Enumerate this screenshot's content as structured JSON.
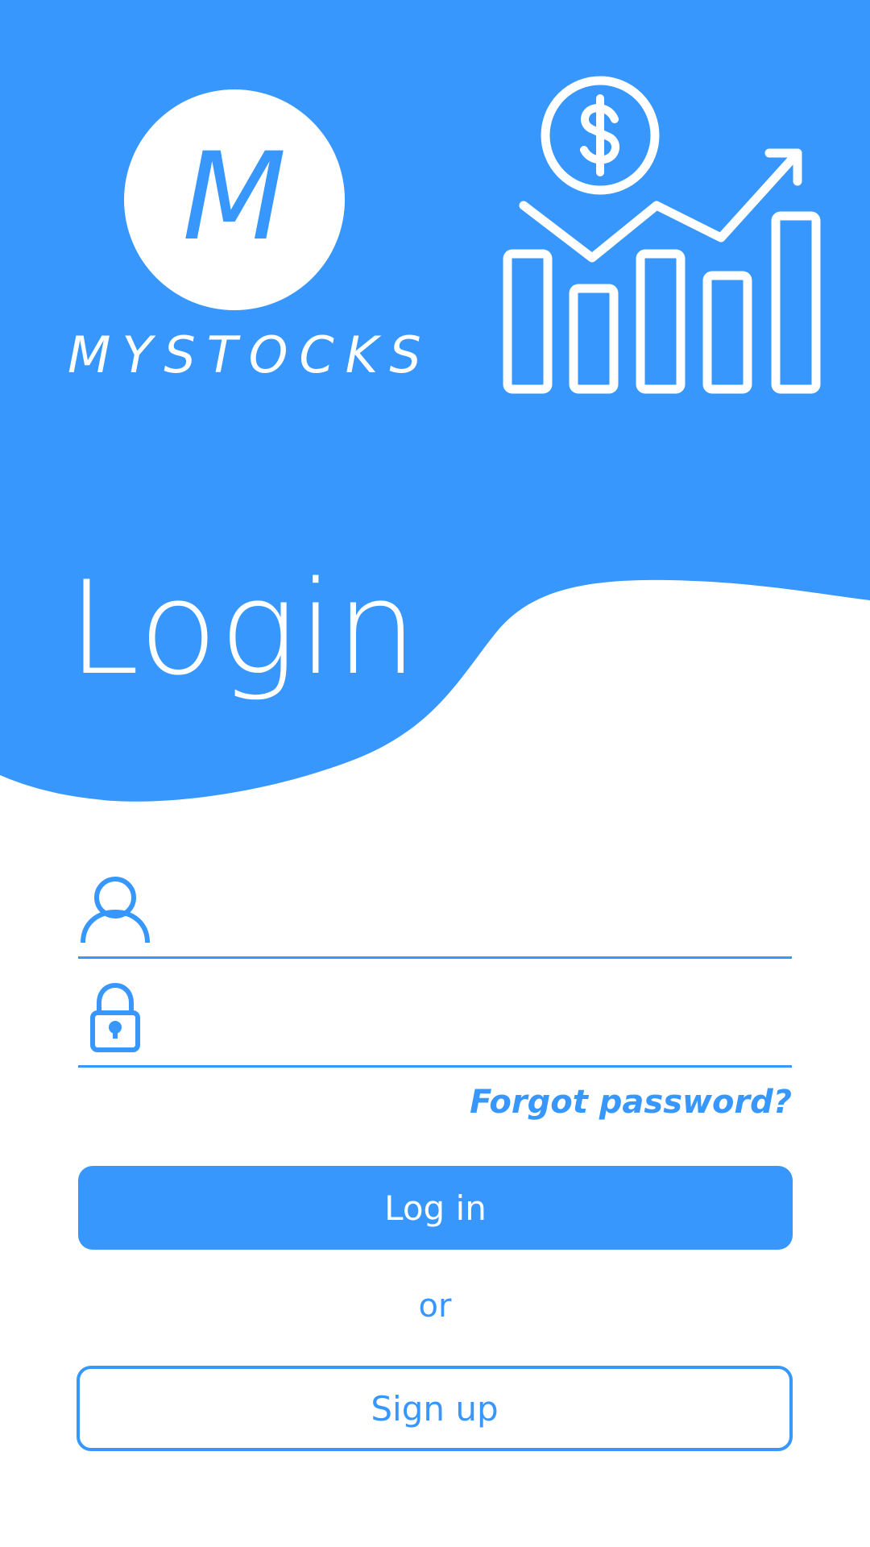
{
  "brand": {
    "logo_letter": "M",
    "name": "MYSTOCKS"
  },
  "page": {
    "title": "Login"
  },
  "form": {
    "username": {
      "value": "",
      "placeholder": ""
    },
    "password": {
      "value": "",
      "placeholder": ""
    },
    "forgot_label": "Forgot password?",
    "login_label": "Log in",
    "or_label": "or",
    "signup_label": "Sign up"
  },
  "icons": {
    "logo": "m-logo-icon",
    "hero": "stock-growth-chart-icon",
    "user": "user-icon",
    "password": "lock-icon"
  },
  "colors": {
    "primary": "#3797fc",
    "background": "#ffffff",
    "on_primary": "#ffffff"
  }
}
